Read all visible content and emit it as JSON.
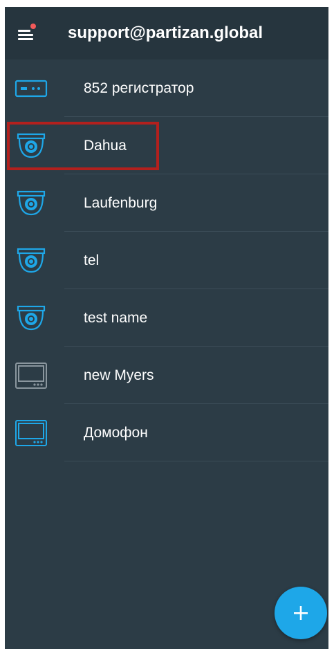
{
  "header": {
    "title": "support@partizan.global",
    "menu_icon": "hamburger-menu-icon",
    "notification_dot_color": "#f25a5a"
  },
  "devices": [
    {
      "label": "852 регистратор",
      "icon": "dvr-recorder-icon",
      "color": "#1ea7e8"
    },
    {
      "label": "Dahua",
      "icon": "dome-camera-icon",
      "color": "#1ea7e8"
    },
    {
      "label": "Laufenburg",
      "icon": "dome-camera-icon",
      "color": "#1ea7e8"
    },
    {
      "label": "tel",
      "icon": "dome-camera-icon",
      "color": "#1ea7e8"
    },
    {
      "label": "test name",
      "icon": "dome-camera-icon",
      "color": "#1ea7e8"
    },
    {
      "label": "new Myers",
      "icon": "intercom-monitor-icon",
      "color": "#8a969e"
    },
    {
      "label": "Домофон",
      "icon": "intercom-monitor-icon",
      "color": "#1ea7e8"
    }
  ],
  "fab": {
    "icon": "plus-icon",
    "color": "#1ea7e8"
  },
  "highlight_color": "#b3201d"
}
